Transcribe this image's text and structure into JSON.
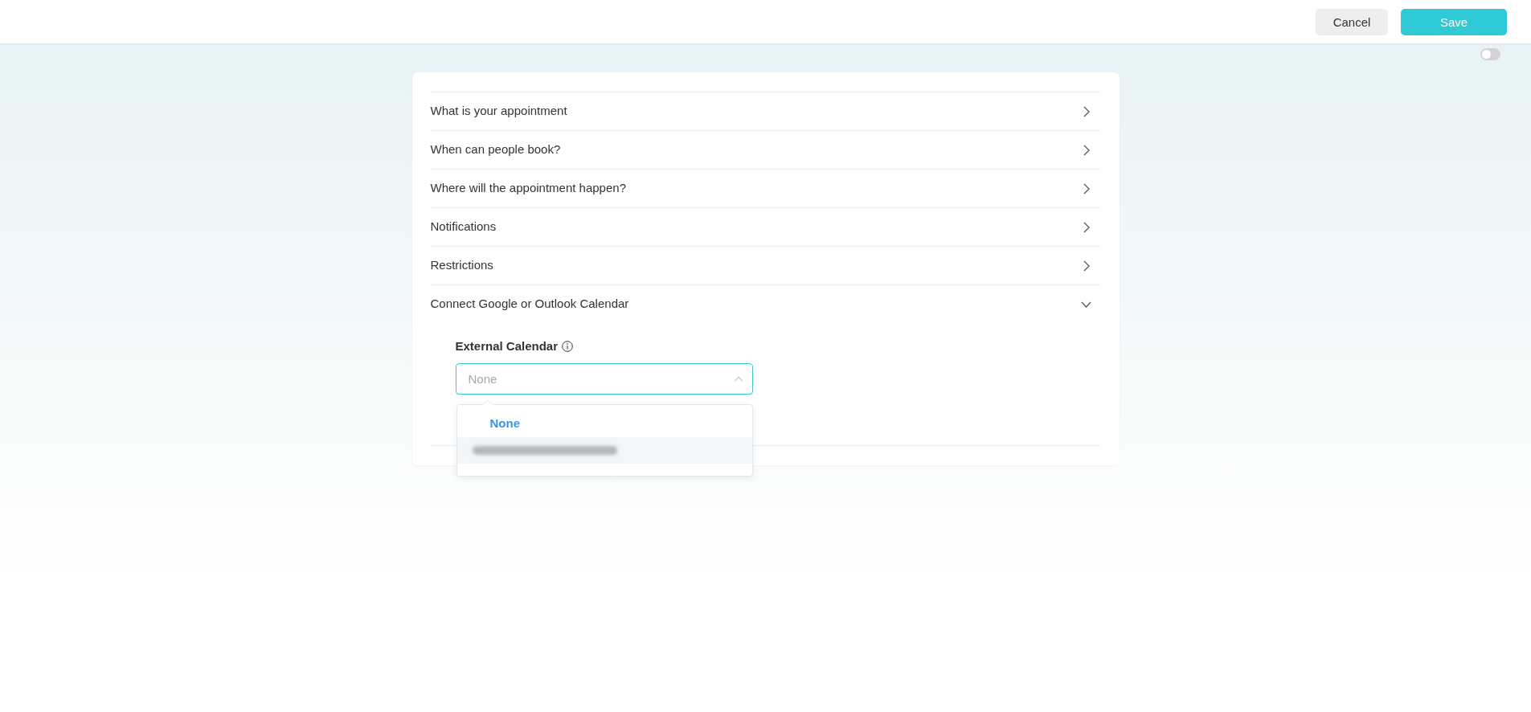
{
  "header": {
    "buttons": [
      {
        "label": "Cancel",
        "kind": "secondary"
      },
      {
        "label": "Save",
        "kind": "primary"
      }
    ],
    "toggle": {
      "on": false
    }
  },
  "sections": [
    {
      "title": "What is your appointment",
      "expanded": false
    },
    {
      "title": "When can people book?",
      "expanded": false
    },
    {
      "title": "Where will the appointment happen?",
      "expanded": false
    },
    {
      "title": "Notifications",
      "expanded": false
    },
    {
      "title": "Restrictions",
      "expanded": false
    },
    {
      "title": "Connect Google or Outlook Calendar",
      "expanded": true,
      "field": {
        "label": "External Calendar",
        "placeholder": "None",
        "open": true,
        "options": [
          {
            "kind": "text",
            "label": "None",
            "selected": true,
            "highlighted": false
          },
          {
            "kind": "redacted",
            "selected": false,
            "highlighted": true
          }
        ]
      }
    }
  ]
}
